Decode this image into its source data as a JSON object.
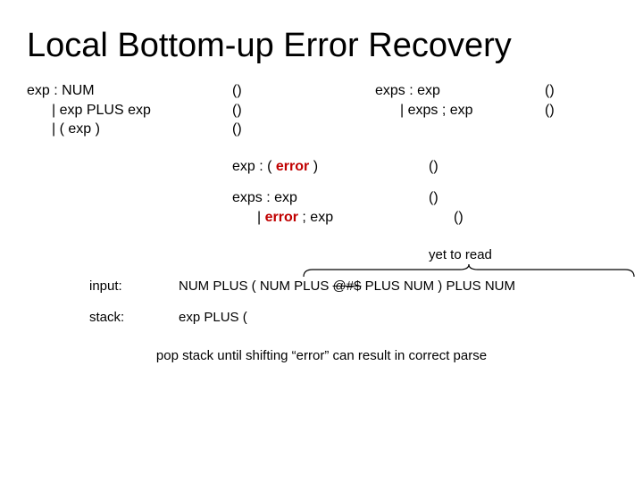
{
  "title": "Local Bottom-up Error Recovery",
  "g1": {
    "l1": "exp : NUM",
    "l2": "| exp PLUS exp",
    "l3": "| ( exp )",
    "a1": "()",
    "a2": "()",
    "a3": "()"
  },
  "g2": {
    "l1": "exps : exp",
    "l2": "| exps ; exp",
    "a1": "()",
    "a2": "()"
  },
  "g3": {
    "pre": "exp : ( ",
    "err": "error",
    "post": " )",
    "a": "()"
  },
  "g4": {
    "l1": "exps : exp",
    "l2pre": "| ",
    "l2err": "error",
    "l2post": " ; exp",
    "a1": "()",
    "a2": "()"
  },
  "yet": "yet to read",
  "input": {
    "label": "input:",
    "p1": "NUM PLUS ( NUM PLUS ",
    "garbage": "@#$",
    "p2": " PLUS NUM ) PLUS NUM"
  },
  "stack": {
    "label": "stack:",
    "value": "exp PLUS ("
  },
  "footer": "pop stack until shifting “error” can result in correct parse"
}
